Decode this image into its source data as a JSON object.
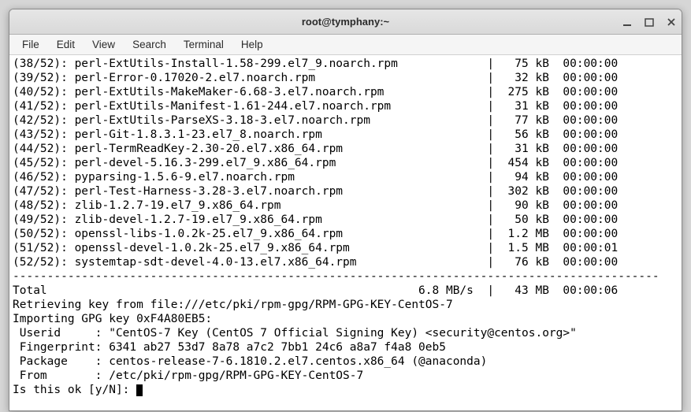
{
  "window": {
    "title": "root@tymphany:~"
  },
  "menubar": {
    "items": [
      "File",
      "Edit",
      "View",
      "Search",
      "Terminal",
      "Help"
    ]
  },
  "downloads": [
    {
      "idx": "(38/52):",
      "pkg": "perl-ExtUtils-Install-1.58-299.el7_9.noarch.rpm",
      "size": "75 kB",
      "time": "00:00:00"
    },
    {
      "idx": "(39/52):",
      "pkg": "perl-Error-0.17020-2.el7.noarch.rpm",
      "size": "32 kB",
      "time": "00:00:00"
    },
    {
      "idx": "(40/52):",
      "pkg": "perl-ExtUtils-MakeMaker-6.68-3.el7.noarch.rpm",
      "size": "275 kB",
      "time": "00:00:00"
    },
    {
      "idx": "(41/52):",
      "pkg": "perl-ExtUtils-Manifest-1.61-244.el7.noarch.rpm",
      "size": "31 kB",
      "time": "00:00:00"
    },
    {
      "idx": "(42/52):",
      "pkg": "perl-ExtUtils-ParseXS-3.18-3.el7.noarch.rpm",
      "size": "77 kB",
      "time": "00:00:00"
    },
    {
      "idx": "(43/52):",
      "pkg": "perl-Git-1.8.3.1-23.el7_8.noarch.rpm",
      "size": "56 kB",
      "time": "00:00:00"
    },
    {
      "idx": "(44/52):",
      "pkg": "perl-TermReadKey-2.30-20.el7.x86_64.rpm",
      "size": "31 kB",
      "time": "00:00:00"
    },
    {
      "idx": "(45/52):",
      "pkg": "perl-devel-5.16.3-299.el7_9.x86_64.rpm",
      "size": "454 kB",
      "time": "00:00:00"
    },
    {
      "idx": "(46/52):",
      "pkg": "pyparsing-1.5.6-9.el7.noarch.rpm",
      "size": "94 kB",
      "time": "00:00:00"
    },
    {
      "idx": "(47/52):",
      "pkg": "perl-Test-Harness-3.28-3.el7.noarch.rpm",
      "size": "302 kB",
      "time": "00:00:00"
    },
    {
      "idx": "(48/52):",
      "pkg": "zlib-1.2.7-19.el7_9.x86_64.rpm",
      "size": "90 kB",
      "time": "00:00:00"
    },
    {
      "idx": "(49/52):",
      "pkg": "zlib-devel-1.2.7-19.el7_9.x86_64.rpm",
      "size": "50 kB",
      "time": "00:00:00"
    },
    {
      "idx": "(50/52):",
      "pkg": "openssl-libs-1.0.2k-25.el7_9.x86_64.rpm",
      "size": "1.2 MB",
      "time": "00:00:00"
    },
    {
      "idx": "(51/52):",
      "pkg": "openssl-devel-1.0.2k-25.el7_9.x86_64.rpm",
      "size": "1.5 MB",
      "time": "00:00:01"
    },
    {
      "idx": "(52/52):",
      "pkg": "systemtap-sdt-devel-4.0-13.el7.x86_64.rpm",
      "size": "76 kB",
      "time": "00:00:00"
    }
  ],
  "total": {
    "label": "Total",
    "rate": "6.8 MB/s",
    "size": "43 MB",
    "time": "00:00:06"
  },
  "retrieve": "Retrieving key from file:///etc/pki/rpm-gpg/RPM-GPG-KEY-CentOS-7",
  "importing": "Importing GPG key 0xF4A80EB5:",
  "gpg": {
    "userid_label": " Userid     :",
    "userid_value": "\"CentOS-7 Key (CentOS 7 Official Signing Key) <security@centos.org>\"",
    "finger_label": " Fingerprint:",
    "finger_value": "6341 ab27 53d7 8a78 a7c2 7bb1 24c6 a8a7 f4a8 0eb5",
    "package_label": " Package    :",
    "package_value": "centos-release-7-6.1810.2.el7.centos.x86_64 (@anaconda)",
    "from_label": " From       :",
    "from_value": "/etc/pki/rpm-gpg/RPM-GPG-KEY-CentOS-7"
  },
  "prompt": "Is this ok [y/N]: "
}
